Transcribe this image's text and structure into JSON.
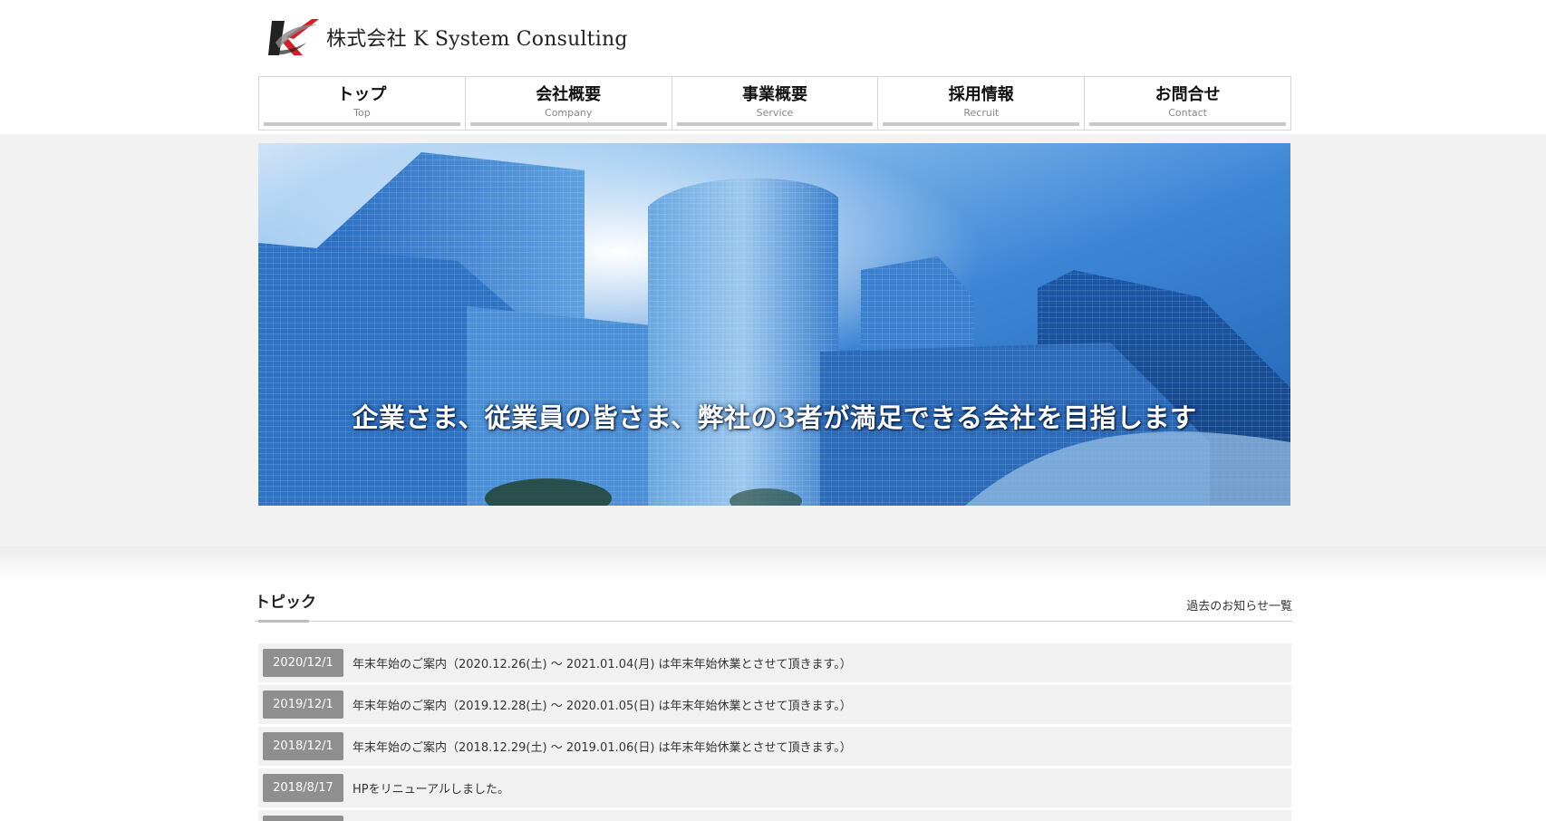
{
  "header": {
    "company_name": "株式会社 K System Consulting"
  },
  "nav": {
    "items": [
      {
        "jp": "トップ",
        "en": "Top"
      },
      {
        "jp": "会社概要",
        "en": "Company"
      },
      {
        "jp": "事業概要",
        "en": "Service"
      },
      {
        "jp": "採用情報",
        "en": "Recruit"
      },
      {
        "jp": "お問合せ",
        "en": "Contact"
      }
    ]
  },
  "hero": {
    "caption": "企業さま、従業員の皆さま、弊社の3者が満足できる会社を目指します"
  },
  "topics": {
    "title": "トピック",
    "past_link": "過去のお知らせ一覧",
    "items": [
      {
        "date": "2020/12/1",
        "text": "年末年始のご案内（2020.12.26(土) ～ 2021.01.04(月) は年末年始休業とさせて頂きます。）"
      },
      {
        "date": "2019/12/1",
        "text": "年末年始のご案内（2019.12.28(土) ～ 2020.01.05(日) は年末年始休業とさせて頂きます。）"
      },
      {
        "date": "2018/12/1",
        "text": "年末年始のご案内（2018.12.29(土) ～ 2019.01.06(日) は年末年始休業とさせて頂きます。）"
      },
      {
        "date": "2018/8/17",
        "text": "HPをリニューアルしました。"
      }
    ]
  },
  "colors": {
    "badge": "#8f8f8f",
    "row_bg": "#f1f1f1",
    "band_bg": "#f2f2f2",
    "logo_red": "#d0202a"
  }
}
